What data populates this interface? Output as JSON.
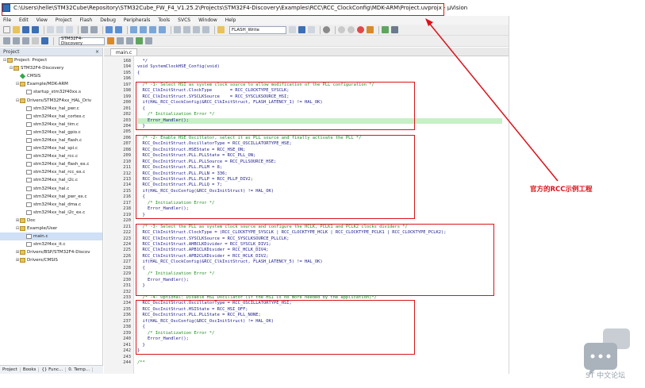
{
  "window": {
    "title": "C:\\Users\\helle\\STM32Cube\\Repository\\STM32Cube_FW_F4_V1.25.2\\Projects\\STM32F4-Discovery\\Examples\\RCC\\RCC_ClockConfig\\MDK-ARM\\Project.uvprojx - µVision"
  },
  "menu": [
    "File",
    "Edit",
    "View",
    "Project",
    "Flash",
    "Debug",
    "Peripherals",
    "Tools",
    "SVCS",
    "Window",
    "Help"
  ],
  "toolbar": {
    "find_value": "FLASH_Write",
    "target_value": "STM32F4-Discovery"
  },
  "project_panel": {
    "title": "Project",
    "close": "×",
    "tree": [
      {
        "label": "Project: Project",
        "depth": 0,
        "icon": "project-icon",
        "exp": "⊟"
      },
      {
        "label": "STM32F4-Discovery",
        "depth": 1,
        "icon": "folder-icon",
        "exp": "⊟"
      },
      {
        "label": "CMSIS",
        "depth": 2,
        "icon": "gem-icon",
        "exp": ""
      },
      {
        "label": "Example/MDK-ARM",
        "depth": 2,
        "icon": "folder-icon",
        "exp": "⊟"
      },
      {
        "label": "startup_stm32f40xx.s",
        "depth": 3,
        "icon": "file-icon",
        "exp": ""
      },
      {
        "label": "Drivers/STM32F4xx_HAL_Driv",
        "depth": 2,
        "icon": "folder-icon",
        "exp": "⊟"
      },
      {
        "label": "stm32f4xx_hal_pwr.c",
        "depth": 3,
        "icon": "file-icon",
        "exp": ""
      },
      {
        "label": "stm32f4xx_hal_cortex.c",
        "depth": 3,
        "icon": "file-icon",
        "exp": ""
      },
      {
        "label": "stm32f4xx_hal_tim.c",
        "depth": 3,
        "icon": "file-icon",
        "exp": ""
      },
      {
        "label": "stm32f4xx_hal_gpio.c",
        "depth": 3,
        "icon": "file-icon",
        "exp": ""
      },
      {
        "label": "stm32f4xx_hal_flash.c",
        "depth": 3,
        "icon": "file-icon",
        "exp": ""
      },
      {
        "label": "stm32f4xx_hal_spi.c",
        "depth": 3,
        "icon": "file-icon",
        "exp": ""
      },
      {
        "label": "stm32f4xx_hal_rcc.c",
        "depth": 3,
        "icon": "file-icon",
        "exp": ""
      },
      {
        "label": "stm32f4xx_hal_flash_ex.c",
        "depth": 3,
        "icon": "file-icon",
        "exp": ""
      },
      {
        "label": "stm32f4xx_hal_rcc_ex.c",
        "depth": 3,
        "icon": "file-icon",
        "exp": ""
      },
      {
        "label": "stm32f4xx_hal_i2c.c",
        "depth": 3,
        "icon": "file-icon",
        "exp": ""
      },
      {
        "label": "stm32f4xx_hal.c",
        "depth": 3,
        "icon": "file-icon",
        "exp": ""
      },
      {
        "label": "stm32f4xx_hal_pwr_ex.c",
        "depth": 3,
        "icon": "file-icon",
        "exp": ""
      },
      {
        "label": "stm32f4xx_hal_dma.c",
        "depth": 3,
        "icon": "file-icon",
        "exp": ""
      },
      {
        "label": "stm32f4xx_hal_i2c_ex.c",
        "depth": 3,
        "icon": "file-icon",
        "exp": ""
      },
      {
        "label": "Doc",
        "depth": 2,
        "icon": "folder-icon",
        "exp": "⊞"
      },
      {
        "label": "Example/User",
        "depth": 2,
        "icon": "folder-icon",
        "exp": "⊟"
      },
      {
        "label": "main.c",
        "depth": 3,
        "icon": "file-icon",
        "exp": "",
        "selected": true
      },
      {
        "label": "stm32f4xx_it.c",
        "depth": 3,
        "icon": "file-icon",
        "exp": ""
      },
      {
        "label": "Drivers/BSP/STM32F4-Discov",
        "depth": 2,
        "icon": "folder-icon",
        "exp": "⊞"
      },
      {
        "label": "Drivers/CMSIS",
        "depth": 2,
        "icon": "folder-icon",
        "exp": "⊞"
      }
    ]
  },
  "bottom_tabs": [
    "Project",
    "Books",
    "{} Func...",
    "0. Temp..."
  ],
  "editor": {
    "tab": "main.c",
    "lines": [
      {
        "n": "168",
        "t": "  */",
        "k": "c"
      },
      {
        "n": "194",
        "t": "void SystemClockHSE_Config(void)",
        "k": "c"
      },
      {
        "n": "195",
        "t": "{",
        "k": "c"
      },
      {
        "n": "196",
        "t": "",
        "k": "c"
      },
      {
        "n": "197",
        "t": "  /* -1- Select HSI as system clock source to allow modification of the PLL configuration */",
        "k": "m"
      },
      {
        "n": "198",
        "t": "  RCC_ClkInitStruct.ClockType       = RCC_CLOCKTYPE_SYSCLK;",
        "k": "c"
      },
      {
        "n": "199",
        "t": "  RCC_ClkInitStruct.SYSCLKSource    = RCC_SYSCLKSOURCE_HSI;",
        "k": "c"
      },
      {
        "n": "200",
        "t": "  if(HAL_RCC_ClockConfig(&RCC_ClkInitStruct, FLASH_LATENCY_1) != HAL_OK)",
        "k": "c"
      },
      {
        "n": "201",
        "t": "  {",
        "k": "c"
      },
      {
        "n": "202",
        "t": "    /* Initialization Error */",
        "k": "m"
      },
      {
        "n": "203",
        "t": "    Error_Handler();",
        "k": "h"
      },
      {
        "n": "204",
        "t": "  }",
        "k": "c"
      },
      {
        "n": "205",
        "t": "",
        "k": "c"
      },
      {
        "n": "206",
        "t": "  /* -2- Enable HSE Oscillator, select it as PLL source and finally activate the PLL */",
        "k": "m"
      },
      {
        "n": "207",
        "t": "  RCC_OscInitStruct.OscillatorType = RCC_OSCILLATORTYPE_HSE;",
        "k": "c"
      },
      {
        "n": "208",
        "t": "  RCC_OscInitStruct.HSEState = RCC_HSE_ON;",
        "k": "c"
      },
      {
        "n": "209",
        "t": "  RCC_OscInitStruct.PLL.PLLState = RCC_PLL_ON;",
        "k": "c"
      },
      {
        "n": "210",
        "t": "  RCC_OscInitStruct.PLL.PLLSource = RCC_PLLSOURCE_HSE;",
        "k": "c"
      },
      {
        "n": "211",
        "t": "  RCC_OscInitStruct.PLL.PLLM = 8;",
        "k": "c"
      },
      {
        "n": "212",
        "t": "  RCC_OscInitStruct.PLL.PLLN = 336;",
        "k": "c"
      },
      {
        "n": "213",
        "t": "  RCC_OscInitStruct.PLL.PLLP = RCC_PLLP_DIV2;",
        "k": "c"
      },
      {
        "n": "214",
        "t": "  RCC_OscInitStruct.PLL.PLLQ = 7;",
        "k": "c"
      },
      {
        "n": "215",
        "t": "  if(HAL_RCC_OscConfig(&RCC_OscInitStruct) != HAL_OK)",
        "k": "c"
      },
      {
        "n": "216",
        "t": "  {",
        "k": "c"
      },
      {
        "n": "217",
        "t": "    /* Initialization Error */",
        "k": "m"
      },
      {
        "n": "218",
        "t": "    Error_Handler();",
        "k": "c"
      },
      {
        "n": "219",
        "t": "  }",
        "k": "c"
      },
      {
        "n": "220",
        "t": "",
        "k": "c"
      },
      {
        "n": "221",
        "t": "  /* -3- Select the PLL as system clock source and configure the HCLK, PCLK1 and PCLK2 clocks dividers */",
        "k": "m"
      },
      {
        "n": "222",
        "t": "  RCC_ClkInitStruct.ClockType = (RCC_CLOCKTYPE_SYSCLK | RCC_CLOCKTYPE_HCLK | RCC_CLOCKTYPE_PCLK1 | RCC_CLOCKTYPE_PCLK2);",
        "k": "c"
      },
      {
        "n": "223",
        "t": "  RCC_ClkInitStruct.SYSCLKSource = RCC_SYSCLKSOURCE_PLLCLK;",
        "k": "c"
      },
      {
        "n": "224",
        "t": "  RCC_ClkInitStruct.AHBCLKDivider = RCC_SYSCLK_DIV1;",
        "k": "c"
      },
      {
        "n": "225",
        "t": "  RCC_ClkInitStruct.APB1CLKDivider = RCC_HCLK_DIV4;",
        "k": "c"
      },
      {
        "n": "226",
        "t": "  RCC_ClkInitStruct.APB2CLKDivider = RCC_HCLK_DIV2;",
        "k": "c"
      },
      {
        "n": "227",
        "t": "  if(HAL_RCC_ClockConfig(&RCC_ClkInitStruct, FLASH_LATENCY_5) != HAL_OK)",
        "k": "c"
      },
      {
        "n": "228",
        "t": "  {",
        "k": "c"
      },
      {
        "n": "229",
        "t": "    /* Initialization Error */",
        "k": "m"
      },
      {
        "n": "230",
        "t": "    Error_Handler();",
        "k": "c"
      },
      {
        "n": "231",
        "t": "  }",
        "k": "c"
      },
      {
        "n": "232",
        "t": "",
        "k": "c"
      },
      {
        "n": "233",
        "t": "  /* -4- Optional: Disable HSI Oscillator (if the HSI is no more needed by the application)*/",
        "k": "m"
      },
      {
        "n": "234",
        "t": "  RCC_OscInitStruct.OscillatorType = RCC_OSCILLATORTYPE_HSI;",
        "k": "c"
      },
      {
        "n": "235",
        "t": "  RCC_OscInitStruct.HSIState = RCC_HSI_OFF;",
        "k": "c"
      },
      {
        "n": "236",
        "t": "  RCC_OscInitStruct.PLL.PLLState = RCC_PLL_NONE;",
        "k": "c"
      },
      {
        "n": "237",
        "t": "  if(HAL_RCC_OscConfig(&RCC_OscInitStruct) != HAL_OK)",
        "k": "c"
      },
      {
        "n": "238",
        "t": "  {",
        "k": "c"
      },
      {
        "n": "239",
        "t": "    /* Initialization Error */",
        "k": "m"
      },
      {
        "n": "240",
        "t": "    Error_Handler();",
        "k": "c"
      },
      {
        "n": "241",
        "t": "  }",
        "k": "c"
      },
      {
        "n": "242",
        "t": "}",
        "k": "c"
      },
      {
        "n": "243",
        "t": "",
        "k": "c"
      },
      {
        "n": "244",
        "t": "/**",
        "k": "m"
      }
    ]
  },
  "annotation": {
    "text": "官方的RCC示例工程",
    "color": "#d9141b"
  },
  "watermark": {
    "text": "ST 中文论坛"
  },
  "colors": {
    "keyword": "#1a1a8a",
    "comment": "#1c8a1c",
    "highlight": "#c7f0c7",
    "accent_red": "#d9141b"
  }
}
